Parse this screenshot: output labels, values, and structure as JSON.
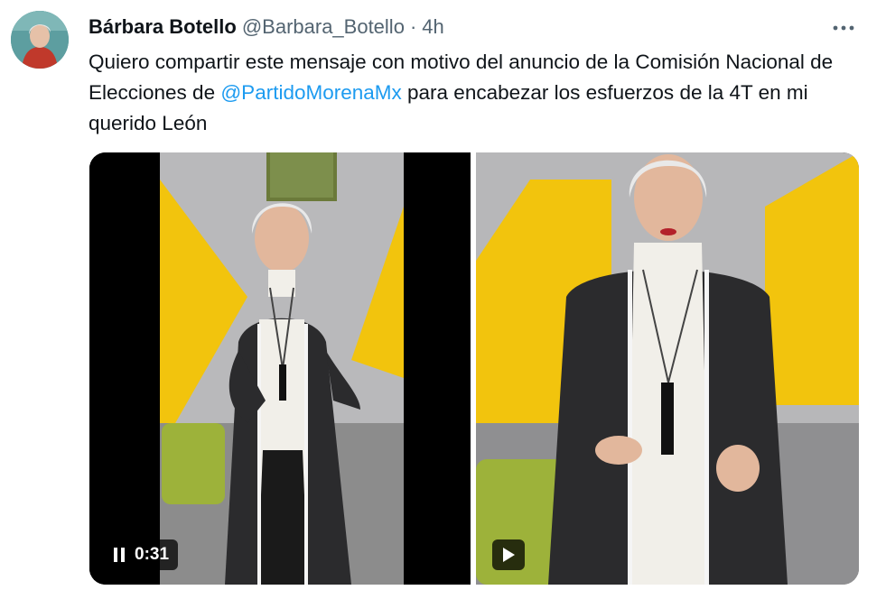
{
  "tweet": {
    "author_name": "Bárbara Botello",
    "handle": "@Barbara_Botello",
    "separator": "·",
    "time": "4h",
    "more_icon": "more-horizontal-icon",
    "text_part1": "Quiero compartir este mensaje con motivo del anuncio de la Comisión Nacional de Elecciones de ",
    "mention": "@PartidoMorenaMx",
    "text_part2": " para encabezar los esfuerzos de la 4T en mi querido León"
  },
  "media": {
    "video1": {
      "control_icon": "pause-icon",
      "duration": "0:31"
    },
    "video2": {
      "control_icon": "play-icon"
    }
  },
  "colors": {
    "mention": "#1d9bf0",
    "secondary_text": "#536471",
    "wall_yellow": "#f2c40d",
    "wall_gray": "#b7b7b9",
    "jacket": "#2b2b2d"
  }
}
